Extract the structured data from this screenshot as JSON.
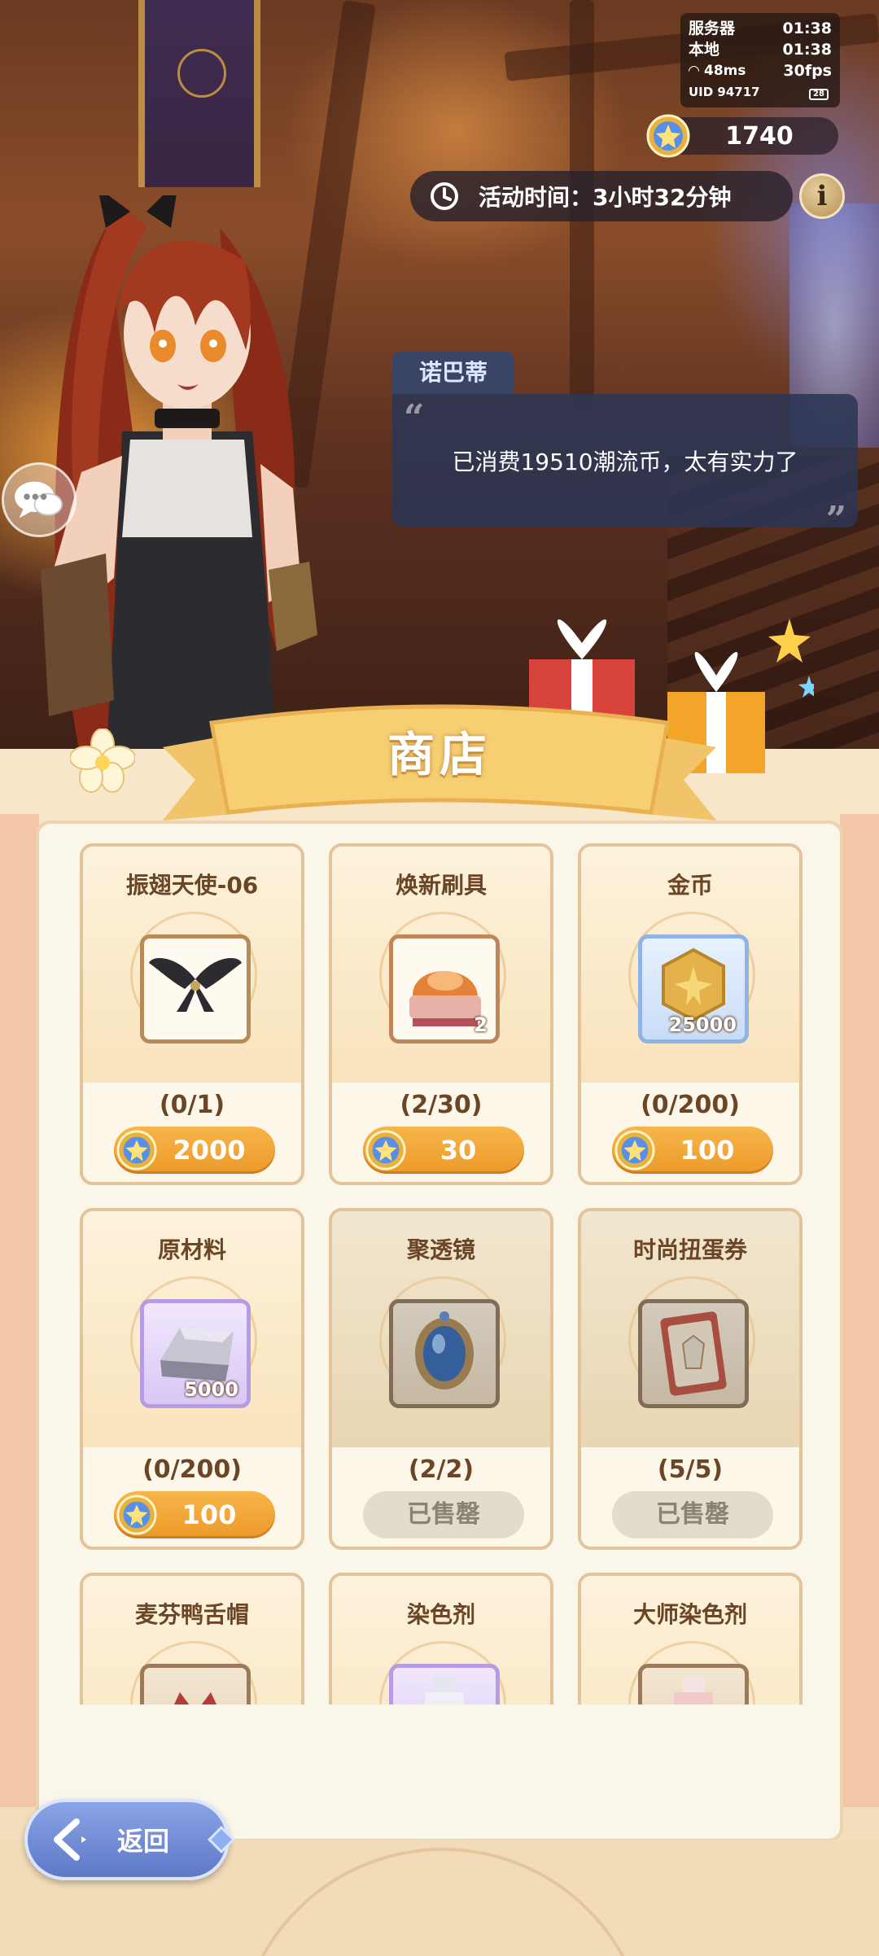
{
  "hud": {
    "server_label": "服务器",
    "server_time": "01:38",
    "local_label": "本地",
    "local_time": "01:38",
    "ping": "48ms",
    "fps": "30fps",
    "uid": "UID 94717",
    "battery": "28"
  },
  "currency": {
    "amount": "1740",
    "icon": "star-coin-icon"
  },
  "event": {
    "timer_text": "活动时间：3小时32分钟"
  },
  "dialog": {
    "speaker": "诺巴蒂",
    "text": "已消费19510潮流币，太有实力了"
  },
  "shop": {
    "title": "商店",
    "items": [
      {
        "name": "振翅天使-06",
        "limit": "(0/1)",
        "price": "2000",
        "qty": "",
        "sold_out": false,
        "icon": "wings-icon"
      },
      {
        "name": "焕新刷具",
        "limit": "(2/30)",
        "price": "30",
        "qty": "2",
        "sold_out": false,
        "icon": "brush-icon"
      },
      {
        "name": "金币",
        "limit": "(0/200)",
        "price": "100",
        "qty": "25000",
        "sold_out": false,
        "icon": "gold-coin-icon"
      },
      {
        "name": "原材料",
        "limit": "(0/200)",
        "price": "100",
        "qty": "5000",
        "sold_out": false,
        "icon": "ingot-icon"
      },
      {
        "name": "聚透镜",
        "limit": "(2/2)",
        "sold_label": "已售罄",
        "qty": "",
        "sold_out": true,
        "icon": "mirror-icon"
      },
      {
        "name": "时尚扭蛋券",
        "limit": "(5/5)",
        "sold_label": "已售罄",
        "qty": "",
        "sold_out": true,
        "icon": "gacha-ticket-icon"
      },
      {
        "name": "麦芬鸭舌帽",
        "icon": "cap-icon"
      },
      {
        "name": "染色剂",
        "icon": "dye-bottle-icon"
      },
      {
        "name": "大师染色剂",
        "icon": "master-dye-icon"
      }
    ]
  },
  "back_button": {
    "label": "返回"
  },
  "colors": {
    "accent_orange": "#ec9a2a",
    "panel_border": "#e3c49a",
    "back_blue": "#5e79c6"
  }
}
